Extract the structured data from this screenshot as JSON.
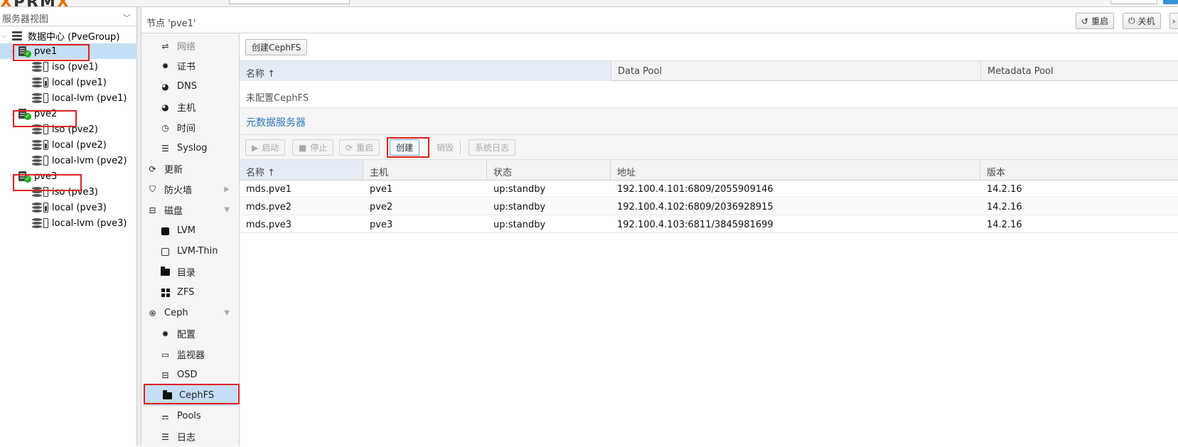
{
  "top": {
    "logo_a": "PR",
    "logo_x": "X",
    "logo_b": "M",
    "logo_c": "X"
  },
  "tree": {
    "view_label": "服务器视图",
    "datacenter": "数据中心 (PveGroup)",
    "nodes": [
      {
        "name": "pve1",
        "storages": [
          "iso (pve1)",
          "local (pve1)",
          "local-lvm (pve1)"
        ]
      },
      {
        "name": "pve2",
        "storages": [
          "iso (pve2)",
          "local (pve2)",
          "local-lvm (pve2)"
        ]
      },
      {
        "name": "pve3",
        "storages": [
          "iso (pve3)",
          "local (pve3)",
          "local-lvm (pve3)"
        ]
      }
    ]
  },
  "header": {
    "title": "节点 'pve1'",
    "reboot": "重启",
    "shutdown": "关机",
    "more": "›"
  },
  "nav": {
    "network": "网络",
    "certificates": "证书",
    "dns": "DNS",
    "hosts": "主机",
    "time": "时间",
    "syslog": "Syslog",
    "updates": "更新",
    "firewall": "防火墙",
    "disks": "磁盘",
    "lvm": "LVM",
    "lvm_thin": "LVM-Thin",
    "directory": "目录",
    "zfs": "ZFS",
    "ceph": "Ceph",
    "config": "配置",
    "monitor": "监视器",
    "osd": "OSD",
    "cephfs": "CephFS",
    "pools": "Pools",
    "log": "日志"
  },
  "cephfs": {
    "create_button": "创建CephFS",
    "columns": [
      "名称 ↑",
      "Data Pool",
      "Metadata Pool"
    ],
    "empty_text": "未配置CephFS"
  },
  "mds": {
    "title": "元数据服务器",
    "toolbar": {
      "start": "启动",
      "stop": "停止",
      "restart": "重启",
      "create": "创建",
      "destroy": "销毁",
      "syslog": "系统日志"
    },
    "columns": [
      "名称 ↑",
      "主机",
      "状态",
      "地址",
      "版本"
    ],
    "rows": [
      {
        "name": "mds.pve1",
        "host": "pve1",
        "status": "up:standby",
        "address": "192.100.4.101:6809/2055909146",
        "version": "14.2.16"
      },
      {
        "name": "mds.pve2",
        "host": "pve2",
        "status": "up:standby",
        "address": "192.100.4.102:6809/2036928915",
        "version": "14.2.16"
      },
      {
        "name": "mds.pve3",
        "host": "pve3",
        "status": "up:standby",
        "address": "192.100.4.103:6811/3845981699",
        "version": "14.2.16"
      }
    ]
  },
  "colors": {
    "selection": "#c5def5",
    "highlight_box": "#e02020",
    "link_blue": "#2f78b8",
    "status_ok": "#21b021"
  }
}
